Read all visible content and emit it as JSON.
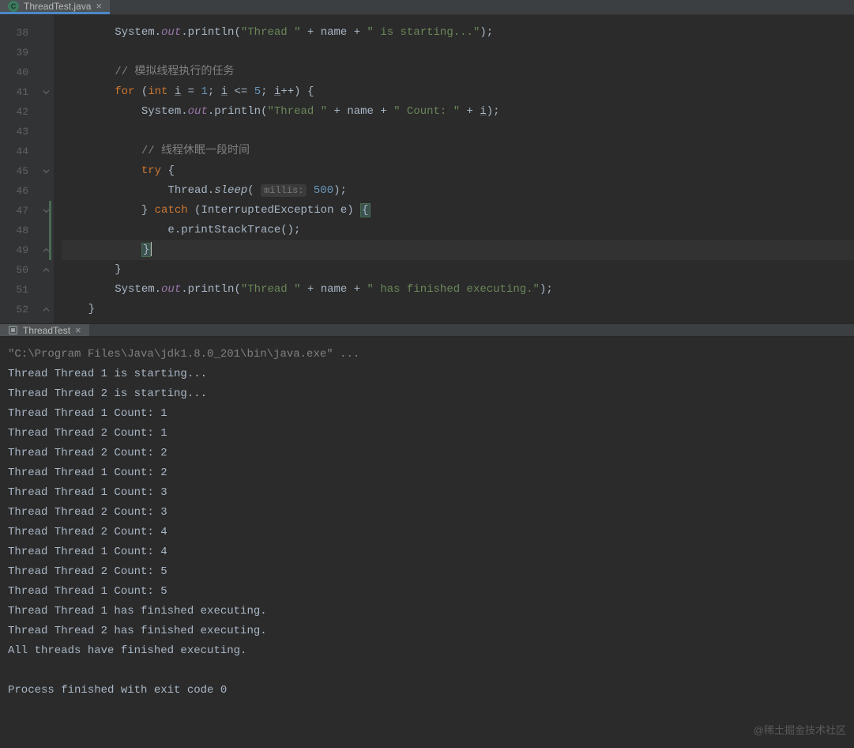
{
  "editor": {
    "tab": {
      "filename": "ThreadTest.java",
      "icon_letter": "C"
    },
    "startLine": 38,
    "lines": [
      {
        "n": 38,
        "indent": 2,
        "type": "print",
        "parts": [
          "System.",
          "out",
          ".println(",
          "\"Thread \"",
          " + name + ",
          "\" is starting...\"",
          ");"
        ]
      },
      {
        "n": 39,
        "indent": 2,
        "type": "blank"
      },
      {
        "n": 40,
        "indent": 2,
        "type": "comment",
        "text": "// 模拟线程执行的任务"
      },
      {
        "n": 41,
        "indent": 2,
        "type": "for",
        "fold": true
      },
      {
        "n": 42,
        "indent": 3,
        "type": "print-count"
      },
      {
        "n": 43,
        "indent": 3,
        "type": "blank"
      },
      {
        "n": 44,
        "indent": 3,
        "type": "comment",
        "text": "// 线程休眠一段时间"
      },
      {
        "n": 45,
        "indent": 3,
        "type": "try",
        "fold": true
      },
      {
        "n": 46,
        "indent": 4,
        "type": "sleep"
      },
      {
        "n": 47,
        "indent": 3,
        "type": "catch",
        "fold": true,
        "change": true
      },
      {
        "n": 48,
        "indent": 4,
        "type": "stack",
        "change": true
      },
      {
        "n": 49,
        "indent": 3,
        "type": "close-brace-match",
        "fold": true,
        "change": true,
        "highlight": true
      },
      {
        "n": 50,
        "indent": 2,
        "type": "close-brace",
        "fold": true
      },
      {
        "n": 51,
        "indent": 2,
        "type": "print-finish"
      },
      {
        "n": 52,
        "indent": 1,
        "type": "close-brace",
        "fold": true
      }
    ],
    "strings": {
      "comment1": "// 模拟线程执行的任务",
      "comment2": "// 线程休眠一段时间",
      "thread_prefix": "\"Thread \"",
      "starting": "\" is starting...\"",
      "count": "\" Count: \"",
      "finished": "\" has finished executing.\"",
      "for_kw": "for",
      "int_kw": "int",
      "try_kw": "try",
      "catch_kw": "catch",
      "hint_millis": "millis:",
      "sleep_val": "500",
      "loop_start": "1",
      "loop_end": "5",
      "exception": "InterruptedException"
    }
  },
  "run": {
    "tab": "ThreadTest",
    "cmd": "\"C:\\Program Files\\Java\\jdk1.8.0_201\\bin\\java.exe\" ...",
    "lines": [
      "Thread Thread 1 is starting...",
      "Thread Thread 2 is starting...",
      "Thread Thread 1 Count: 1",
      "Thread Thread 2 Count: 1",
      "Thread Thread 2 Count: 2",
      "Thread Thread 1 Count: 2",
      "Thread Thread 1 Count: 3",
      "Thread Thread 2 Count: 3",
      "Thread Thread 2 Count: 4",
      "Thread Thread 1 Count: 4",
      "Thread Thread 2 Count: 5",
      "Thread Thread 1 Count: 5",
      "Thread Thread 1 has finished executing.",
      "Thread Thread 2 has finished executing.",
      "All threads have finished executing.",
      "",
      "Process finished with exit code 0"
    ]
  },
  "watermark": "@稀土掘金技术社区"
}
